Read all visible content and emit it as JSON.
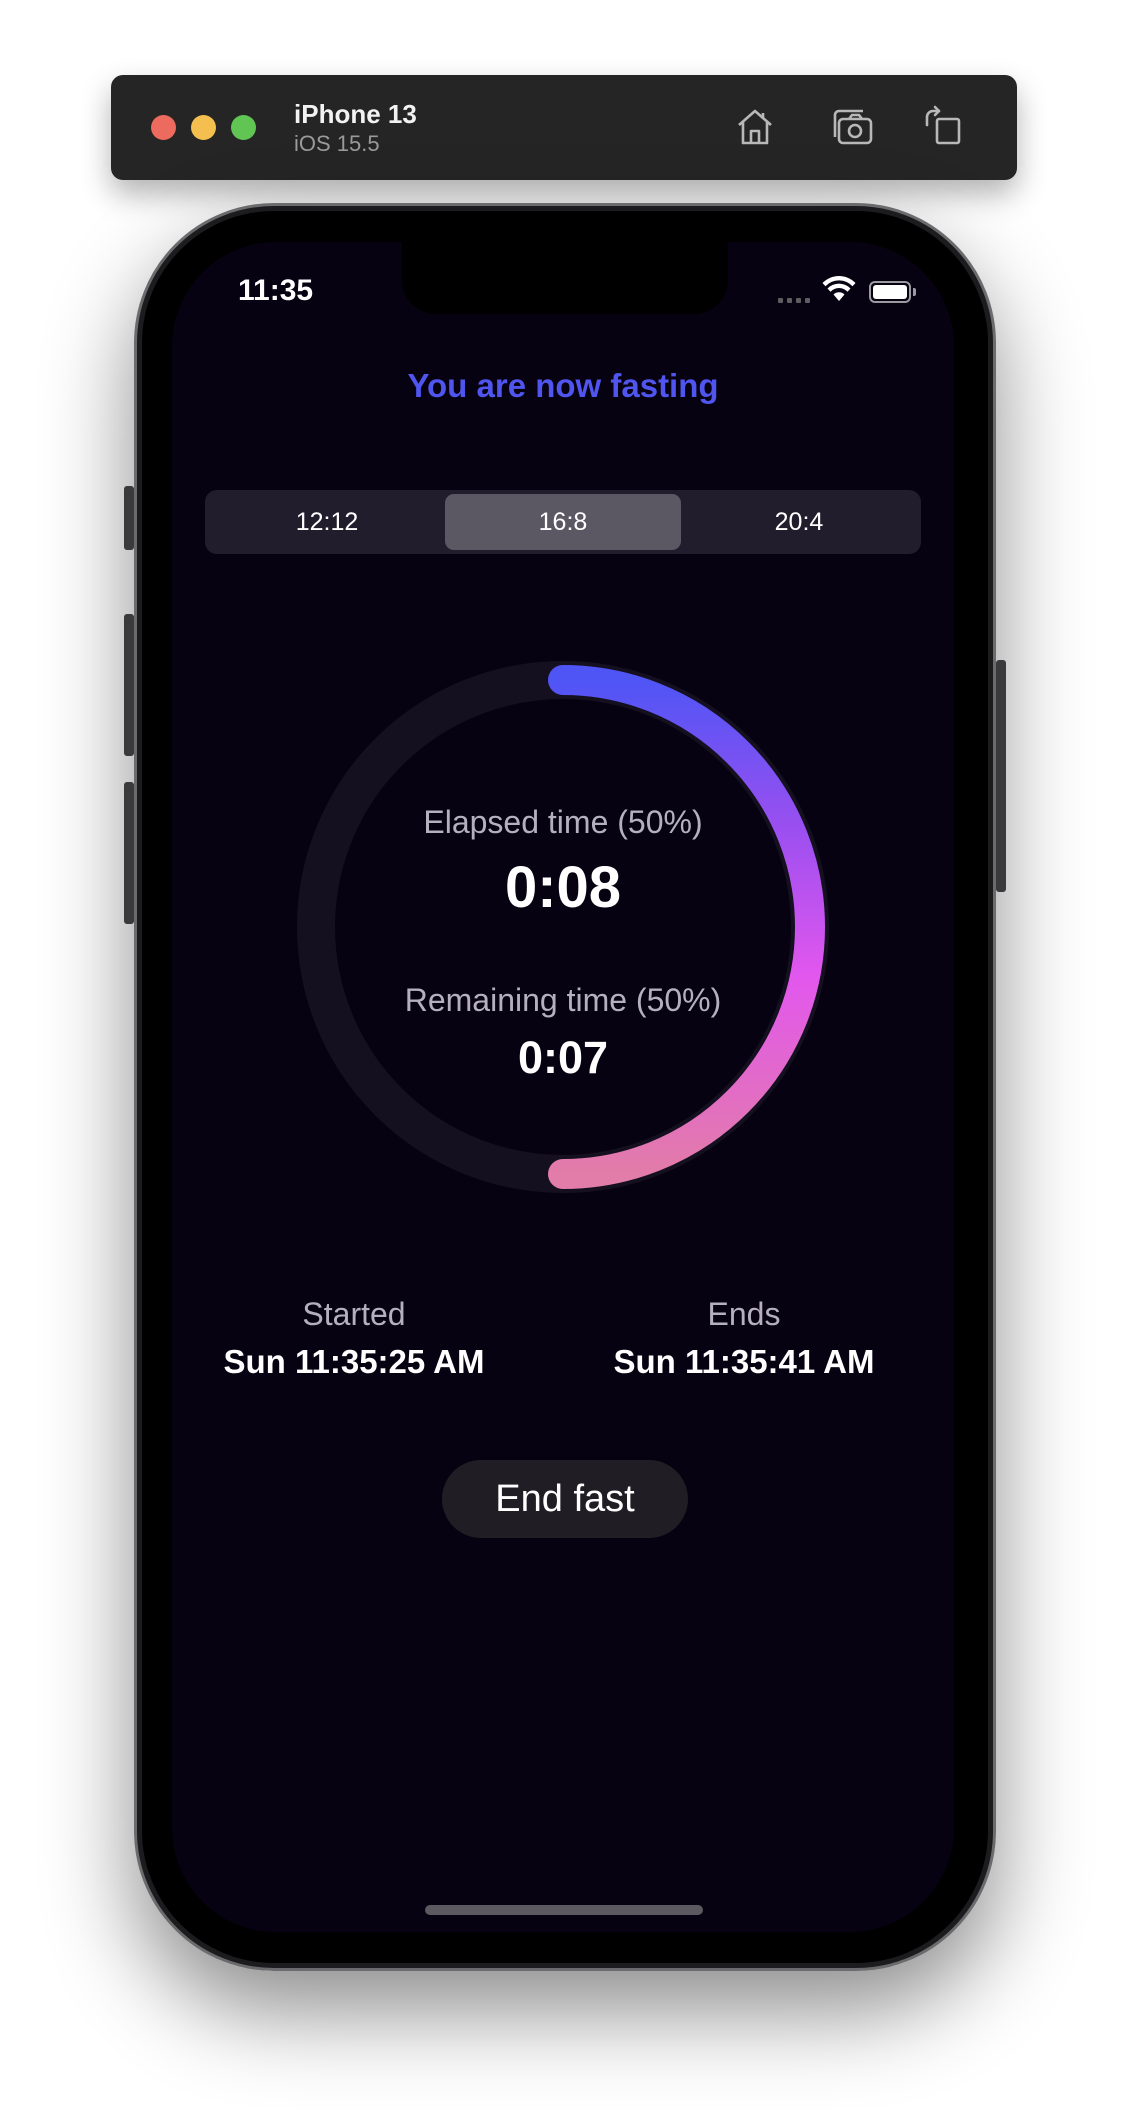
{
  "simulator": {
    "device_name": "iPhone 13",
    "os_version": "iOS 15.5",
    "toolbar_icons": [
      "home-icon",
      "screenshot-icon",
      "rotate-icon"
    ]
  },
  "status_bar": {
    "time": "11:35",
    "icons": [
      "cellular-signal-icon",
      "wifi-icon",
      "battery-icon"
    ]
  },
  "app": {
    "title": "You are now fasting",
    "title_color": "#4f55ee",
    "background_color": "#070211",
    "plans": [
      {
        "label": "12:12",
        "selected": false
      },
      {
        "label": "16:8",
        "selected": true
      },
      {
        "label": "20:4",
        "selected": false
      }
    ],
    "progress": {
      "fraction": 0.5,
      "gradient_colors": [
        "#4f55f5",
        "#9b4ff0",
        "#e257ee",
        "#e27ca8"
      ],
      "track_color": "#15101f"
    },
    "elapsed": {
      "label": "Elapsed time (50%)",
      "value": "0:08"
    },
    "remaining": {
      "label": "Remaining time (50%)",
      "value": "0:07"
    },
    "started": {
      "label": "Started",
      "value": "Sun 11:35:25 AM"
    },
    "ends": {
      "label": "Ends",
      "value": "Sun 11:35:41 AM"
    },
    "end_button_label": "End fast"
  }
}
